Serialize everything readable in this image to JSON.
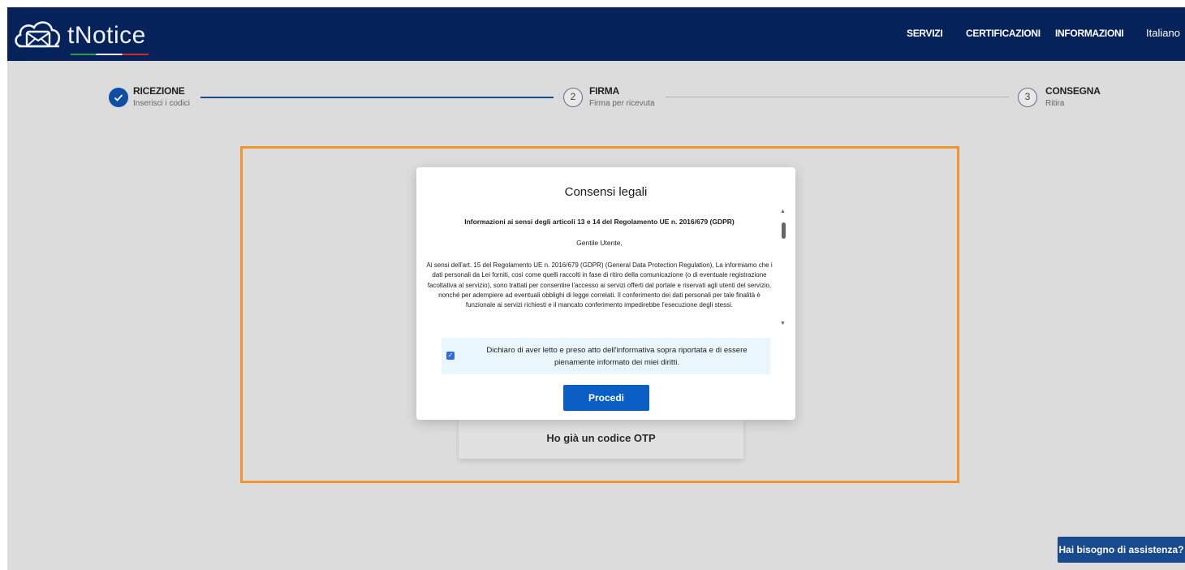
{
  "header": {
    "logo_text": "tNotice",
    "nav": [
      "SERVIZI",
      "CERTIFICAZIONI",
      "INFORMAZIONI"
    ],
    "language": "Italiano"
  },
  "stepper": {
    "steps": [
      {
        "title": "RICEZIONE",
        "subtitle": "Inserisci i codici",
        "state": "done"
      },
      {
        "title": "FIRMA",
        "subtitle": "Firma per ricevuta",
        "number": "2",
        "state": "active"
      },
      {
        "title": "CONSEGNA",
        "subtitle": "Ritira",
        "number": "3",
        "state": "pending"
      }
    ]
  },
  "page": {
    "otp_card_label": "Ho già un codice OTP"
  },
  "modal": {
    "title": "Consensi legali",
    "heading": "Informazioni ai sensi degli articoli 13 e 14 del Regolamento UE n. 2016/679 (GDPR)",
    "greeting": "Gentile Utente,",
    "paragraph": "Ai sensi dell'art. 15 del Regolamento UE n. 2016/679 (GDPR) (General Data Protection Regulation), La informiamo che i dati personali da Lei forniti, così come quelli raccolti in fase di ritiro della comunicazione (o di eventuale registrazione facoltativa al servizio), sono trattati per consentire l'accesso ai servizi offerti dal portale e riservati agli utenti del servizio, nonché per adempiere ad eventuali obblighi di legge correlati. Il conferimento dei dati personali per tale finalità è funzionale ai servizi richiesti e il mancato conferimento impedirebbe l'esecuzione degli stessi.",
    "consent_text": "Dichiaro di aver letto e preso atto dell'informativa sopra riportata e di essere pienamente informato dei miei diritti.",
    "consent_checked": true,
    "proceed_label": "Procedi"
  },
  "help_button_label": "Hai bisogno di assistenza?",
  "colors": {
    "header_bg": "#06225a",
    "primary_button": "#0b5fc4",
    "highlight_frame": "#f39431",
    "help_button": "#194a8d"
  }
}
